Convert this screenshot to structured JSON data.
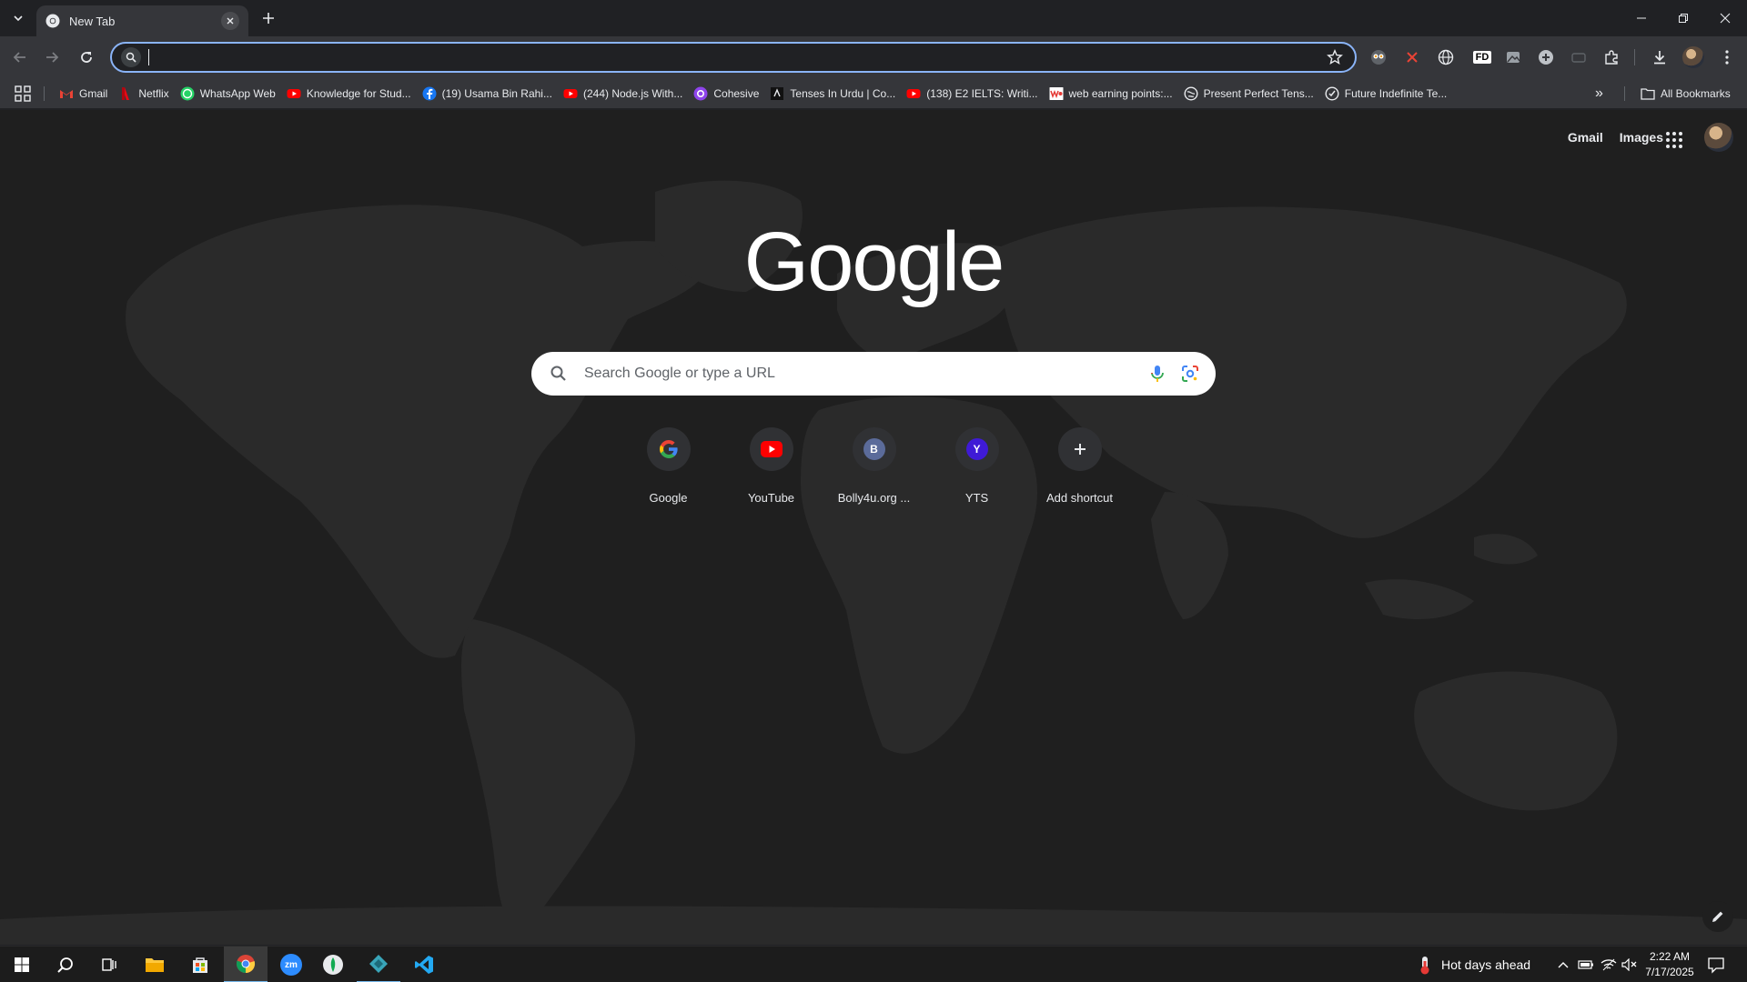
{
  "browser": {
    "tab": {
      "title": "New Tab"
    },
    "omnibox": {
      "value": "",
      "placeholder": ""
    },
    "bookmarks": [
      {
        "label": "Gmail",
        "icon": "gmail-icon",
        "color": "#ea4335"
      },
      {
        "label": "Netflix",
        "icon": "netflix-icon",
        "color": "#e50914"
      },
      {
        "label": "WhatsApp Web",
        "icon": "whatsapp-icon",
        "color": "#25d366"
      },
      {
        "label": "Knowledge for Stud...",
        "icon": "youtube-icon",
        "color": "#ff0000"
      },
      {
        "label": "(19) Usama Bin Rahi...",
        "icon": "facebook-icon",
        "color": "#1877f2"
      },
      {
        "label": "(244) Node.js With...",
        "icon": "youtube-icon",
        "color": "#ff0000"
      },
      {
        "label": "Cohesive",
        "icon": "cohesive-icon",
        "color": "#8e44ec"
      },
      {
        "label": "Tenses In Urdu | Co...",
        "icon": "tenses-icon",
        "color": "#111111"
      },
      {
        "label": "(138) E2 IELTS: Writi...",
        "icon": "youtube-icon",
        "color": "#ff0000"
      },
      {
        "label": "web earning points:...",
        "icon": "wep-icon",
        "color": "#e53935"
      },
      {
        "label": "Present Perfect Tens...",
        "icon": "globe-icon",
        "color": "#e8eaed"
      },
      {
        "label": "Future Indefinite Te...",
        "icon": "globe-icon",
        "color": "#e8eaed"
      }
    ],
    "all_bookmarks_label": "All Bookmarks"
  },
  "ntp": {
    "top_links": {
      "gmail": "Gmail",
      "images": "Images"
    },
    "logo": "Google",
    "search_placeholder": "Search Google or type a URL",
    "shortcuts": [
      {
        "name": "Google",
        "icon": "google-g-icon",
        "letter": ""
      },
      {
        "name": "YouTube",
        "icon": "youtube-icon",
        "letter": ""
      },
      {
        "name": "Bolly4u.org ...",
        "icon": "letter-b-icon",
        "letter": "B",
        "color": "#5b6b9a"
      },
      {
        "name": "YTS",
        "icon": "letter-y-icon",
        "letter": "Y",
        "color": "#3f1ad6"
      },
      {
        "name": "Add shortcut",
        "icon": "plus-icon",
        "letter": "+"
      }
    ]
  },
  "taskbar": {
    "weather": "Hot days ahead",
    "time": "2:22 AM",
    "date": "7/17/2025"
  },
  "colors": {
    "accent": "#8ab4f8",
    "ntp_bg": "#1f1f1f",
    "toolbar_bg": "#35363a"
  }
}
